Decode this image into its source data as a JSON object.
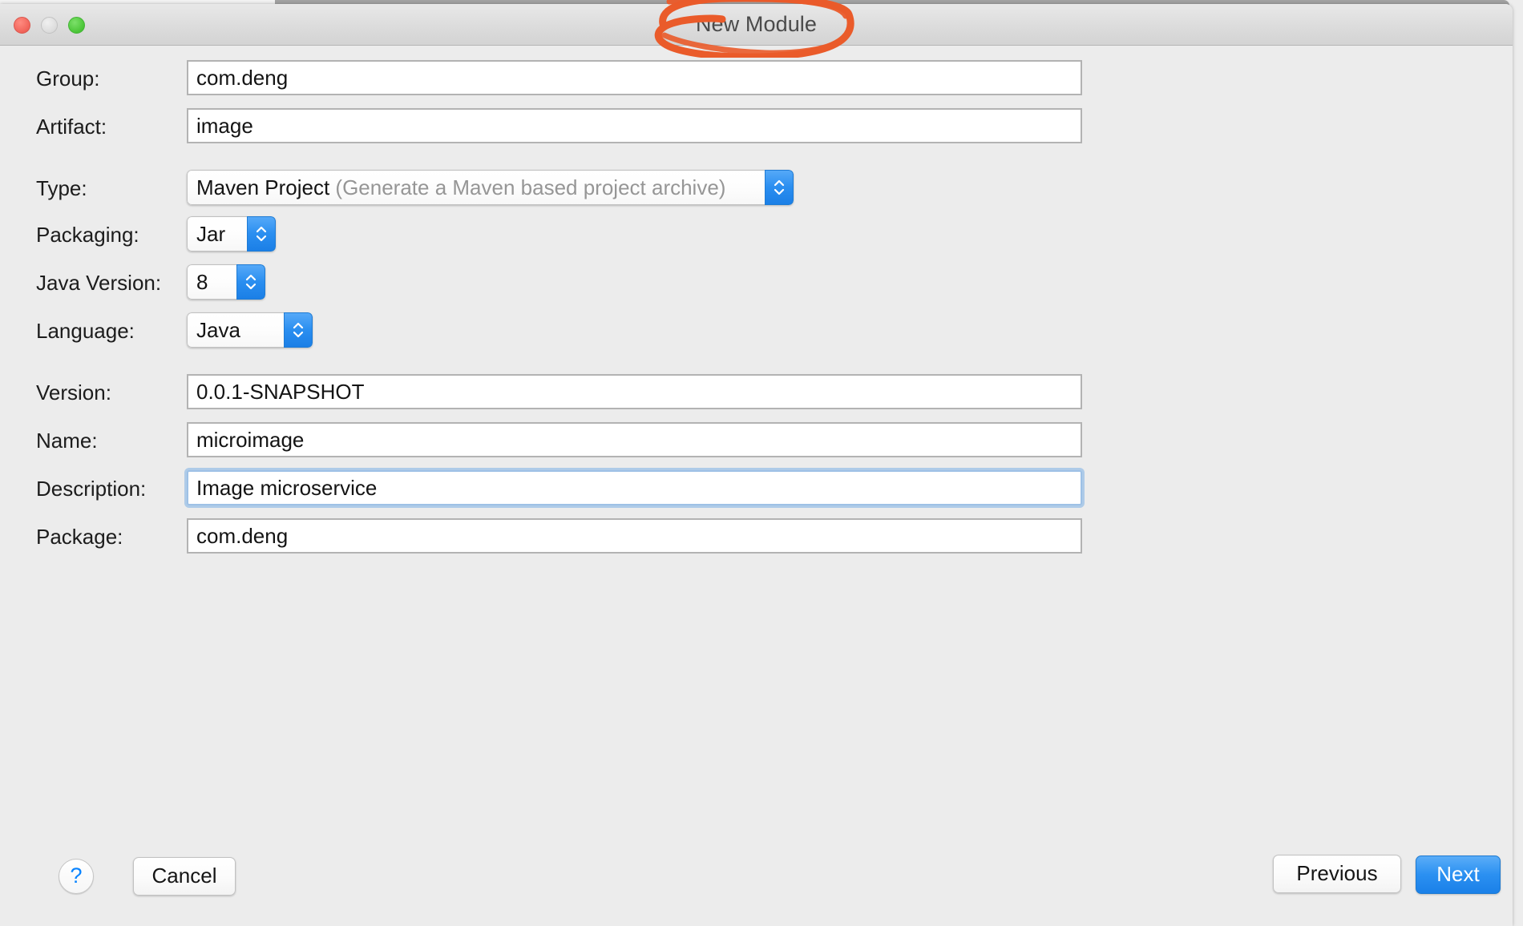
{
  "window": {
    "title": "New Module",
    "controls": [
      {
        "name": "close",
        "color": "#f2665c"
      },
      {
        "name": "minimize",
        "color": "#dddddd"
      },
      {
        "name": "zoom",
        "color": "#4ec73a"
      }
    ]
  },
  "annotation": {
    "shape": "hand-drawn-ellipse",
    "color": "#ea5b2a",
    "target": "New Module"
  },
  "form": {
    "fields": [
      {
        "id": "group",
        "label": "Group:",
        "value": "com.deng",
        "kind": "text"
      },
      {
        "id": "artifact",
        "label": "Artifact:",
        "value": "image",
        "kind": "text"
      },
      {
        "id": "type",
        "label": "Type:",
        "value": "Maven Project",
        "hint": "(Generate a Maven based project archive)",
        "kind": "popup"
      },
      {
        "id": "packaging",
        "label": "Packaging:",
        "value": "Jar",
        "kind": "popup"
      },
      {
        "id": "javaversion",
        "label": "Java Version:",
        "value": "8",
        "kind": "popup"
      },
      {
        "id": "language",
        "label": "Language:",
        "value": "Java",
        "kind": "popup"
      },
      {
        "id": "version",
        "label": "Version:",
        "value": "0.0.1-SNAPSHOT",
        "kind": "text"
      },
      {
        "id": "name",
        "label": "Name:",
        "value": "microimage",
        "kind": "text"
      },
      {
        "id": "description",
        "label": "Description:",
        "value": "Image microservice",
        "kind": "text",
        "focused": true
      },
      {
        "id": "package",
        "label": "Package:",
        "value": "com.deng",
        "kind": "text"
      }
    ]
  },
  "footer": {
    "help_label": "?",
    "cancel_label": "Cancel",
    "previous_label": "Previous",
    "next_label": "Next",
    "accent_color": "#2b90f1"
  }
}
